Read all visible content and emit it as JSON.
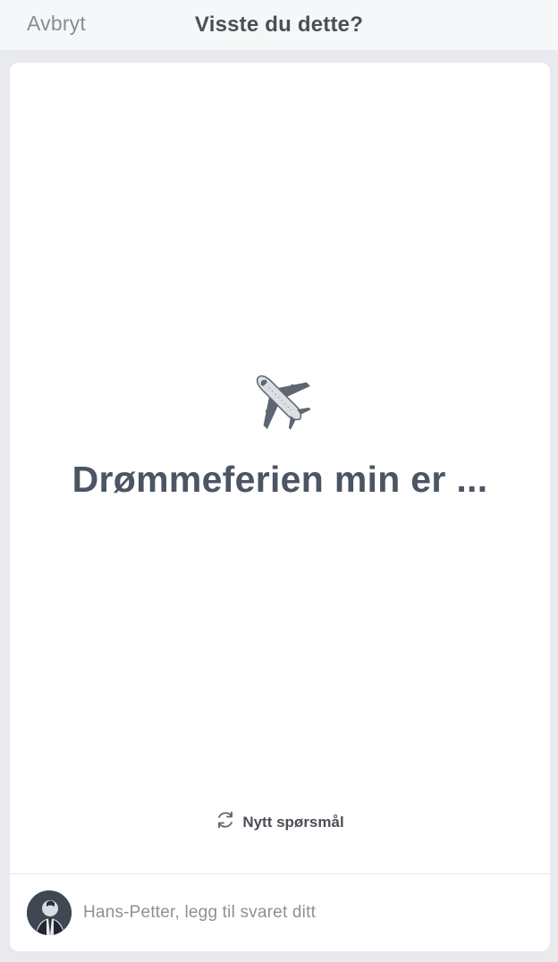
{
  "header": {
    "cancel_label": "Avbryt",
    "title": "Visste du dette?"
  },
  "card": {
    "emoji_icon": "airplane-icon",
    "question": "Drømmeferien min er ...",
    "new_question_icon": "refresh-icon",
    "new_question_label": "Nytt spørsmål"
  },
  "composer": {
    "avatar": "user-avatar",
    "placeholder": "Hans-Petter, legg til svaret ditt"
  },
  "colors": {
    "background": "#e9eaed",
    "card": "#ffffff",
    "text_dark": "#4b5563",
    "text_muted": "#8a8d91"
  }
}
